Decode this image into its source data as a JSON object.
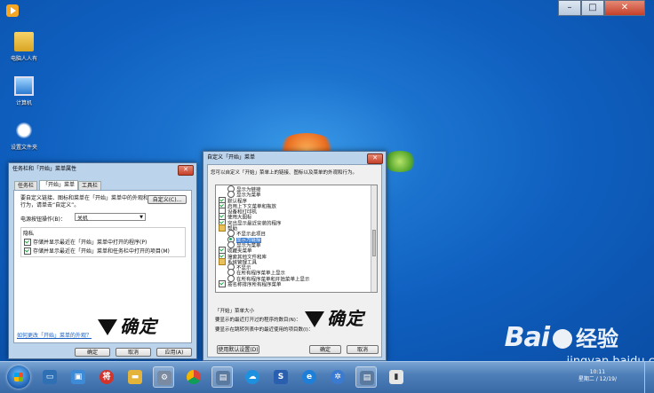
{
  "desktop": {
    "icons": [
      {
        "label": "电脑人人有",
        "name": "user-folder-icon"
      },
      {
        "label": "计算机",
        "name": "computer-icon"
      },
      {
        "label": "设置文件夹",
        "name": "cougar-icon"
      }
    ]
  },
  "colors": {
    "accent": "#1c74cf",
    "taskbar": "#4f7fb8"
  },
  "taskbar_props": {
    "title": "任务栏和「开始」菜单属性",
    "tabs": [
      "任务栏",
      "「开始」菜单",
      "工具栏"
    ],
    "description": "要自定义链接、图标和菜单在「开始」菜单中的外观和行为，请单击“自定义”。",
    "customize_button": "自定义(C)...",
    "power_label": "电源按钮操作(B)：",
    "power_value": "关机",
    "privacy_title": "隐私",
    "privacy_items": [
      "存储并显示最近在「开始」菜单中打开的程序(P)",
      "存储并显示最近在「开始」菜单和任务栏中打开的项目(M)"
    ],
    "help_link": "如何更改「开始」菜单的外观？",
    "ok": "确定",
    "cancel": "取消",
    "apply": "应用(A)"
  },
  "customize": {
    "title": "自定义「开始」菜单",
    "description": "您可以自定义「开始」菜单上的链接、图标以及菜单的外观和行为。",
    "items": [
      {
        "kind": "radio",
        "checked": false,
        "indent": 1,
        "text": "显示为链接"
      },
      {
        "kind": "radio",
        "checked": false,
        "indent": 1,
        "text": "显示为菜单"
      },
      {
        "kind": "check",
        "checked": true,
        "indent": 0,
        "text": "默认程序"
      },
      {
        "kind": "check",
        "checked": true,
        "indent": 0,
        "text": "启用上下文菜单和拖放"
      },
      {
        "kind": "check",
        "checked": false,
        "indent": 0,
        "text": "设备和打印机"
      },
      {
        "kind": "check",
        "checked": true,
        "indent": 0,
        "text": "使用大图标"
      },
      {
        "kind": "check",
        "checked": true,
        "indent": 0,
        "text": "突出显示最近安装的程序"
      },
      {
        "kind": "folder",
        "checked": false,
        "indent": 0,
        "text": "帮助"
      },
      {
        "kind": "radio",
        "checked": false,
        "indent": 1,
        "text": "不显示此项目"
      },
      {
        "kind": "radio",
        "checked": true,
        "indent": 1,
        "text": "显示为链接",
        "selected": true
      },
      {
        "kind": "radio",
        "checked": false,
        "indent": 1,
        "text": "显示为菜单"
      },
      {
        "kind": "check",
        "checked": true,
        "indent": 0,
        "text": "收藏夹菜单"
      },
      {
        "kind": "check",
        "checked": true,
        "indent": 0,
        "text": "搜索其他文件和库"
      },
      {
        "kind": "folder",
        "checked": false,
        "indent": 0,
        "text": "系统管理工具"
      },
      {
        "kind": "radio",
        "checked": false,
        "indent": 1,
        "text": "不显示"
      },
      {
        "kind": "radio",
        "checked": false,
        "indent": 1,
        "text": "在所有程序菜单上显示"
      },
      {
        "kind": "radio",
        "checked": false,
        "indent": 1,
        "text": "在所有程序菜单和开始菜单上显示"
      },
      {
        "kind": "check",
        "checked": true,
        "indent": 0,
        "text": "按名称排序所有程序菜单"
      }
    ],
    "size_title": "「开始」菜单大小",
    "recent_programs_label": "要显示的最近打开过的程序的数目(N)：",
    "recent_items_label": "要显示在跳转列表中的最近使用的项目数(I)：",
    "defaults_button": "使用默认设置(D)",
    "ok": "确定",
    "cancel": "取消"
  },
  "annotation_text": "确定",
  "taskbar_clock": {
    "time": "10:11",
    "date": "星期二 / 12/19/"
  },
  "watermark": {
    "brand": "Bai",
    "brand_cn": "经验",
    "url": "jingyan.baidu.com"
  }
}
